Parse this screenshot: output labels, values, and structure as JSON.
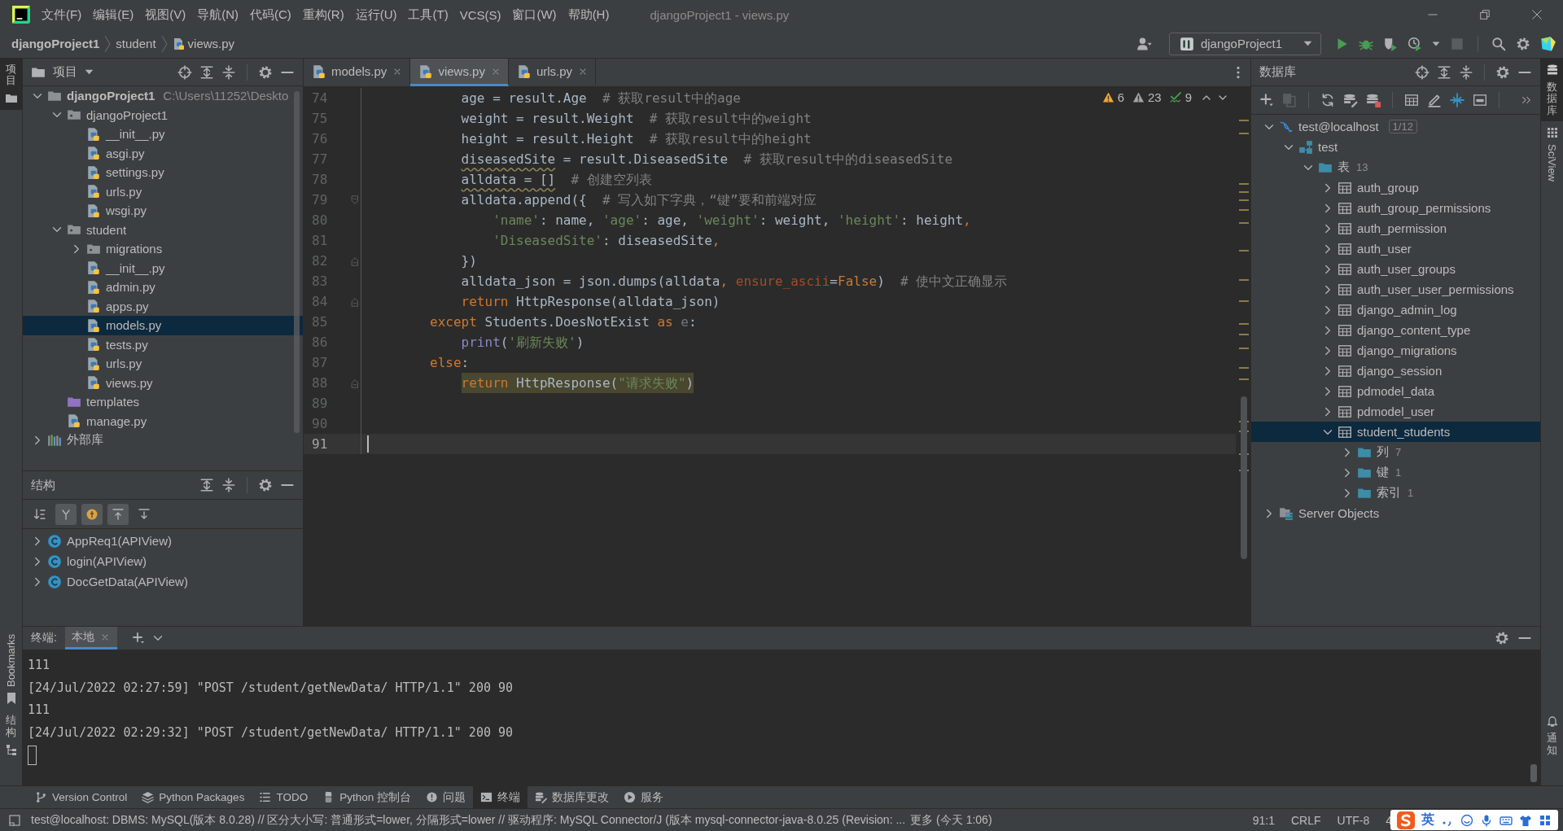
{
  "title_bar": {
    "menus": [
      "文件(F)",
      "编辑(E)",
      "视图(V)",
      "导航(N)",
      "代码(C)",
      "重构(R)",
      "运行(U)",
      "工具(T)",
      "VCS(S)",
      "窗口(W)",
      "帮助(H)"
    ],
    "title": "djangoProject1 - views.py"
  },
  "breadcrumbs": [
    {
      "label": "djangoProject1",
      "kind": "project"
    },
    {
      "label": "student",
      "kind": "folder"
    },
    {
      "label": "views.py",
      "kind": "file"
    }
  ],
  "run_config": {
    "label": "djangoProject1"
  },
  "left_strip": {
    "top": [
      {
        "label": "项目",
        "selected": true
      }
    ],
    "bottom": [
      {
        "label": "Bookmarks",
        "kind": "bookmarks"
      },
      {
        "label": "结构",
        "kind": "structure"
      }
    ]
  },
  "project_panel": {
    "title": "项目",
    "tree": [
      {
        "label": "djangoProject1",
        "kind": "root",
        "path": "C:\\Users\\11252\\Deskto",
        "expanded": true,
        "selected": false,
        "children": [
          {
            "label": "djangoProject1",
            "kind": "module",
            "expanded": true,
            "selected": false,
            "children": [
              {
                "label": "__init__.py",
                "kind": "py",
                "selected": false
              },
              {
                "label": "asgi.py",
                "kind": "py",
                "selected": false
              },
              {
                "label": "settings.py",
                "kind": "py",
                "selected": false
              },
              {
                "label": "urls.py",
                "kind": "py",
                "selected": false
              },
              {
                "label": "wsgi.py",
                "kind": "py",
                "selected": false
              }
            ]
          },
          {
            "label": "student",
            "kind": "module",
            "expanded": true,
            "selected": false,
            "children": [
              {
                "label": "migrations",
                "kind": "module",
                "expanded": false,
                "selected": false
              },
              {
                "label": "__init__.py",
                "kind": "py",
                "selected": false
              },
              {
                "label": "admin.py",
                "kind": "py",
                "selected": false
              },
              {
                "label": "apps.py",
                "kind": "py",
                "selected": false
              },
              {
                "label": "models.py",
                "kind": "py",
                "selected": true
              },
              {
                "label": "tests.py",
                "kind": "py",
                "selected": false
              },
              {
                "label": "urls.py",
                "kind": "py",
                "selected": false
              },
              {
                "label": "views.py",
                "kind": "py",
                "selected": false
              }
            ]
          },
          {
            "label": "templates",
            "kind": "templates",
            "selected": false
          },
          {
            "label": "manage.py",
            "kind": "py",
            "selected": false
          }
        ]
      },
      {
        "label": "外部库",
        "kind": "library",
        "expanded": false,
        "selected": false
      }
    ]
  },
  "structure_panel": {
    "title": "结构",
    "toolbar": [
      {
        "kind": "sort",
        "on": false
      },
      {
        "kind": "inherited",
        "on": true
      },
      {
        "kind": "fields",
        "on": true
      },
      {
        "kind": "scroll-to",
        "on": true
      },
      {
        "kind": "scroll-from",
        "on": false
      }
    ],
    "items": [
      {
        "label": "AppReq1(APIView)",
        "expanded": false
      },
      {
        "label": "login(APIView)",
        "expanded": false
      },
      {
        "label": "DocGetData(APIView)",
        "expanded": false
      }
    ]
  },
  "editor": {
    "tabs": [
      {
        "label": "models.py",
        "selected": false
      },
      {
        "label": "views.py",
        "selected": true
      },
      {
        "label": "urls.py",
        "selected": false
      }
    ],
    "inspections": {
      "warnings": "6",
      "weak_warnings": "23",
      "typos": "9"
    },
    "lines": [
      {
        "number": "74",
        "kind": "statement",
        "tokens": [
          {
            "t": "age = result.Age  ",
            "kind": "plain"
          },
          {
            "t": "# 获取result中的age",
            "kind": "comment"
          }
        ],
        "highlighted": false,
        "current": false
      },
      {
        "number": "75",
        "kind": "statement",
        "tokens": [
          {
            "t": "weight = result.Weight  ",
            "kind": "plain"
          },
          {
            "t": "# 获取result中的weight",
            "kind": "comment"
          }
        ],
        "highlighted": false,
        "current": false
      },
      {
        "number": "76",
        "kind": "statement",
        "tokens": [
          {
            "t": "height = result.Height  ",
            "kind": "plain"
          },
          {
            "t": "# 获取result中的height",
            "kind": "comment"
          }
        ],
        "highlighted": false,
        "current": false
      },
      {
        "number": "77",
        "kind": "statement",
        "tokens": [
          {
            "t": "diseasedSite",
            "kind": "warned"
          },
          {
            "t": " = result.DiseasedSite  ",
            "kind": "plain"
          },
          {
            "t": "# 获取result中的diseasedSite",
            "kind": "comment"
          }
        ],
        "highlighted": false,
        "current": false
      },
      {
        "number": "78",
        "kind": "statement",
        "tokens": [
          {
            "t": "alldata = []",
            "kind": "warned"
          },
          {
            "t": "  # 创建空列表",
            "kind": "comment"
          }
        ],
        "highlighted": false,
        "current": false
      },
      {
        "number": "79",
        "fold": {
          "kind": "start"
        },
        "kind": "statement",
        "tokens": [
          {
            "t": "alldata.append({  ",
            "kind": "plain"
          },
          {
            "t": "# 写入如下字典，“键”要和前端对应",
            "kind": "comment"
          }
        ],
        "highlighted": false,
        "current": false
      },
      {
        "number": "80",
        "kind": "continuation",
        "tokens": [
          {
            "t": "'name'",
            "kind": "string"
          },
          {
            "t": ": name, ",
            "kind": "plain"
          },
          {
            "t": "'age'",
            "kind": "string"
          },
          {
            "t": ": age, ",
            "kind": "plain"
          },
          {
            "t": "'weight'",
            "kind": "string"
          },
          {
            "t": ": weight, ",
            "kind": "plain"
          },
          {
            "t": "'height'",
            "kind": "string"
          },
          {
            "t": ": height",
            "kind": "plain"
          },
          {
            "t": ",",
            "kind": "keyword"
          }
        ],
        "highlighted": false,
        "current": false
      },
      {
        "number": "81",
        "kind": "continuation",
        "tokens": [
          {
            "t": "'DiseasedSite'",
            "kind": "string"
          },
          {
            "t": ": diseasedSite",
            "kind": "plain"
          },
          {
            "t": ",",
            "kind": "keyword"
          }
        ],
        "highlighted": false,
        "current": false
      },
      {
        "number": "82",
        "fold": {
          "kind": "end"
        },
        "kind": "statement",
        "tokens": [
          {
            "t": "})",
            "kind": "plain"
          }
        ],
        "highlighted": false,
        "current": false
      },
      {
        "number": "83",
        "kind": "statement",
        "tokens": [
          {
            "t": "alldata_json = json.dumps(alldata",
            "kind": "plain"
          },
          {
            "t": ",",
            "kind": "keyword"
          },
          {
            "t": " ensure_ascii",
            "kind": "param"
          },
          {
            "t": "=",
            "kind": "plain"
          },
          {
            "t": "False",
            "kind": "keyword"
          },
          {
            "t": ")  ",
            "kind": "plain"
          },
          {
            "t": "# 使中文正确显示",
            "kind": "comment"
          }
        ],
        "highlighted": false,
        "current": false
      },
      {
        "number": "84",
        "fold": {
          "kind": "end"
        },
        "kind": "statement",
        "tokens": [
          {
            "t": "return",
            "kind": "keyword"
          },
          {
            "t": " HttpResponse(alldata_json)",
            "kind": "plain"
          }
        ],
        "highlighted": false,
        "current": false
      },
      {
        "number": "85",
        "kind": "clause",
        "tokens": [
          {
            "t": "except",
            "kind": "keyword"
          },
          {
            "t": " Students.DoesNotExist ",
            "kind": "plain"
          },
          {
            "t": "as",
            "kind": "keyword"
          },
          {
            "t": " e",
            "kind": "dim"
          },
          {
            "t": ":",
            "kind": "plain"
          }
        ],
        "highlighted": false,
        "current": false
      },
      {
        "number": "86",
        "kind": "statement",
        "tokens": [
          {
            "t": "print",
            "kind": "builtin"
          },
          {
            "t": "(",
            "kind": "plain"
          },
          {
            "t": "'刷新失败'",
            "kind": "string"
          },
          {
            "t": ")",
            "kind": "plain"
          }
        ],
        "highlighted": false,
        "current": false
      },
      {
        "number": "87",
        "kind": "clause",
        "tokens": [
          {
            "t": "else",
            "kind": "keyword"
          },
          {
            "t": ":",
            "kind": "plain"
          }
        ],
        "highlighted": false,
        "current": false
      },
      {
        "number": "88",
        "fold": {
          "kind": "end"
        },
        "kind": "statement",
        "tokens": [
          {
            "t": "return",
            "kind": "keyword"
          },
          {
            "t": " HttpResponse(",
            "kind": "plain"
          },
          {
            "t": "\"请求失败\"",
            "kind": "string"
          },
          {
            "t": ")",
            "kind": "plain"
          }
        ],
        "highlighted": true,
        "current": false
      },
      {
        "number": "89",
        "kind": "blank",
        "current": false
      },
      {
        "number": "90",
        "kind": "blank",
        "current": false
      },
      {
        "number": "91",
        "kind": "blank",
        "current": true
      }
    ]
  },
  "database_panel": {
    "title": "数据库",
    "tree": [
      {
        "label": "test@localhost",
        "kind": "connection",
        "badge": "1/12",
        "expanded": true,
        "selected": false,
        "children": [
          {
            "label": "test",
            "kind": "schema",
            "expanded": true,
            "selected": false,
            "children": [
              {
                "label": "表",
                "kind": "folder",
                "count": "13",
                "expanded": true,
                "selected": false,
                "children": [
                  {
                    "label": "auth_group",
                    "kind": "table",
                    "expanded": false,
                    "selected": false
                  },
                  {
                    "label": "auth_group_permissions",
                    "kind": "table",
                    "expanded": false,
                    "selected": false
                  },
                  {
                    "label": "auth_permission",
                    "kind": "table",
                    "expanded": false,
                    "selected": false
                  },
                  {
                    "label": "auth_user",
                    "kind": "table",
                    "expanded": false,
                    "selected": false
                  },
                  {
                    "label": "auth_user_groups",
                    "kind": "table",
                    "expanded": false,
                    "selected": false
                  },
                  {
                    "label": "auth_user_user_permissions",
                    "kind": "table",
                    "expanded": false,
                    "selected": false
                  },
                  {
                    "label": "django_admin_log",
                    "kind": "table",
                    "expanded": false,
                    "selected": false
                  },
                  {
                    "label": "django_content_type",
                    "kind": "table",
                    "expanded": false,
                    "selected": false
                  },
                  {
                    "label": "django_migrations",
                    "kind": "table",
                    "expanded": false,
                    "selected": false
                  },
                  {
                    "label": "django_session",
                    "kind": "table",
                    "expanded": false,
                    "selected": false
                  },
                  {
                    "label": "pdmodel_data",
                    "kind": "table",
                    "expanded": false,
                    "selected": false
                  },
                  {
                    "label": "pdmodel_user",
                    "kind": "table",
                    "expanded": false,
                    "selected": false
                  },
                  {
                    "label": "student_students",
                    "kind": "table",
                    "expanded": true,
                    "selected": true,
                    "children": [
                      {
                        "label": "列",
                        "kind": "folder",
                        "count": "7",
                        "expanded": false,
                        "selected": false
                      },
                      {
                        "label": "键",
                        "kind": "folder",
                        "count": "1",
                        "expanded": false,
                        "selected": false
                      },
                      {
                        "label": "索引",
                        "kind": "folder",
                        "count": "1",
                        "expanded": false,
                        "selected": false
                      }
                    ]
                  }
                ]
              }
            ]
          }
        ]
      },
      {
        "label": "Server Objects",
        "kind": "server",
        "expanded": false,
        "selected": false
      }
    ]
  },
  "right_strip": {
    "top": [
      {
        "label": "数据库",
        "kind": "database",
        "selected": true
      },
      {
        "label": "SciView",
        "kind": "sciview",
        "selected": false
      }
    ],
    "bottom": [
      {
        "label": "通知",
        "kind": "notifications"
      }
    ]
  },
  "terminal": {
    "title": "终端:",
    "tabs": [
      {
        "label": "本地",
        "selected": true
      }
    ],
    "lines": [
      "111",
      "[24/Jul/2022 02:27:59] \"POST /student/getNewData/ HTTP/1.1\" 200 90",
      "111",
      "[24/Jul/2022 02:29:32] \"POST /student/getNewData/ HTTP/1.1\" 200 90"
    ]
  },
  "tool_tabs": [
    {
      "label": "Version Control",
      "kind": "vcs",
      "selected": false
    },
    {
      "label": "Python Packages",
      "kind": "packages",
      "selected": false
    },
    {
      "label": "TODO",
      "kind": "todo",
      "selected": false
    },
    {
      "label": "Python 控制台",
      "kind": "console",
      "selected": false
    },
    {
      "label": "问题",
      "kind": "problems",
      "selected": false
    },
    {
      "label": "终端",
      "kind": "terminal",
      "selected": true
    },
    {
      "label": "数据库更改",
      "kind": "dbchanges",
      "selected": false
    },
    {
      "label": "服务",
      "kind": "services",
      "selected": false
    }
  ],
  "status_bar": {
    "message": "test@localhost: DBMS: MySQL(版本 8.0.28) // 区分大小写: 普通形式=lower, 分隔形式=lower // 驱动程序: MySQL Connector/J (版本 mysql-connector-java-8.0.25 (Revision: ...",
    "more_link": "更多",
    "time": "(今天 1:06)",
    "items": [
      "91:1",
      "CRLF",
      "UTF-8",
      "4"
    ]
  },
  "input_method": {
    "mode": "英"
  }
}
